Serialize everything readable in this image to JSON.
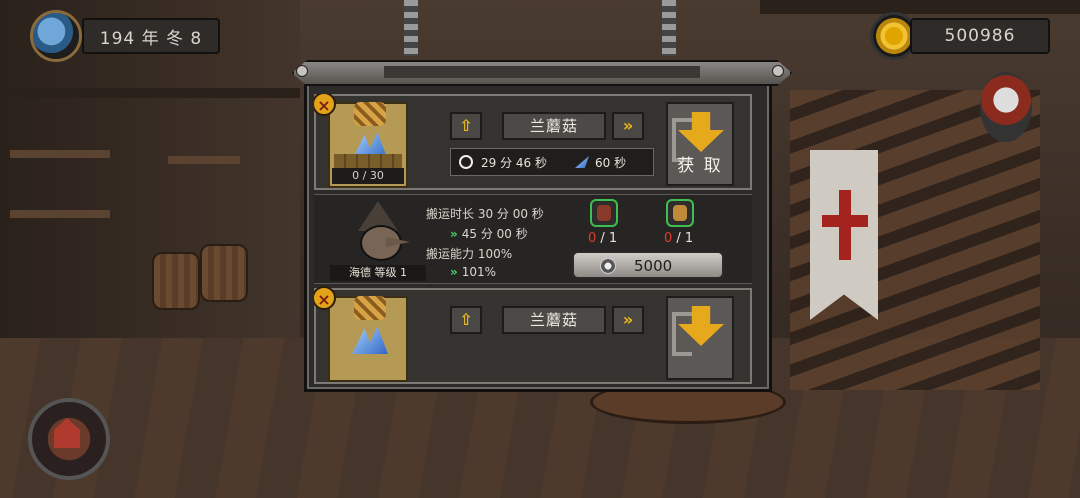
{
  "hud": {
    "date": "194 年 冬 8",
    "money": "500986"
  },
  "cards": [
    {
      "item_name": "兰蘑菇",
      "stock": "0 / 30",
      "time": "29 分 46 秒",
      "speed": "60 秒",
      "get_label": "获 取",
      "close_label": "×"
    },
    {
      "item_name": "兰蘑菇",
      "close_label": "×"
    }
  ],
  "detail": {
    "carry_time_label": "搬运时长 30 分 00 秒",
    "carry_time_upgrade": "45 分 00 秒",
    "carry_ability_label": "搬运能力 100%",
    "carry_ability_upgrade": "101%",
    "upgrade_marker": "»",
    "hero_name": "海德 等级 1",
    "req1_have": "0",
    "req1_need": "/ 1",
    "req2_have": "0",
    "req2_need": "/ 1",
    "cost": "5000"
  },
  "buttons": {
    "up_arrow": "⇧",
    "next_arrow": "»"
  },
  "colors": {
    "accent_gold": "#e7a91c",
    "upgrade_green": "#4fd26b",
    "shortage_red": "#e03c2c"
  }
}
